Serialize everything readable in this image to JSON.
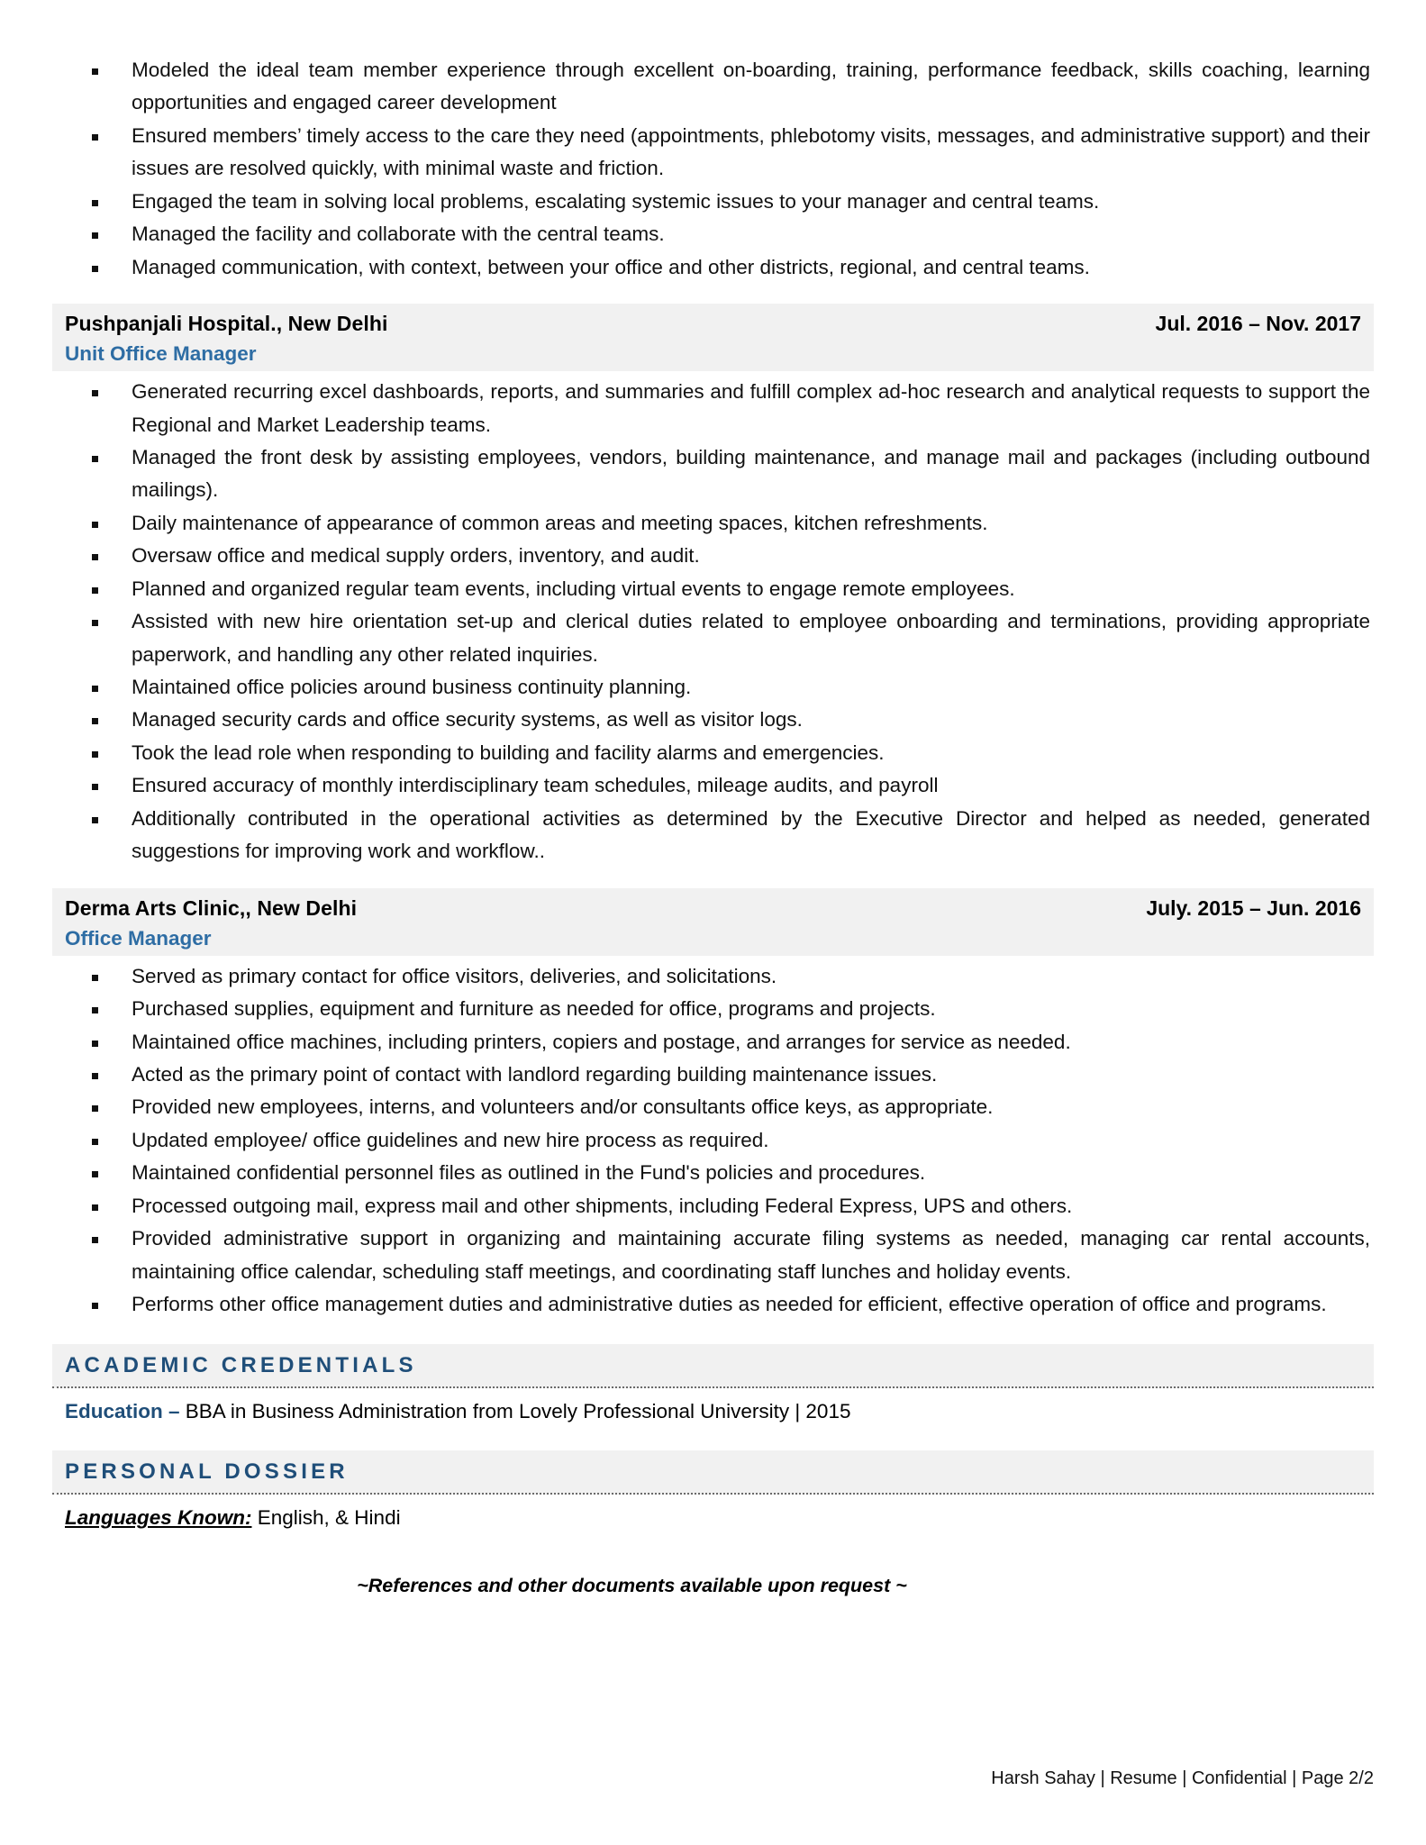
{
  "page": {
    "continued_bullets": [
      "Modeled the ideal team member experience through excellent on-boarding, training, performance feedback, skills coaching, learning opportunities and engaged career development",
      "Ensured members’ timely access to the care they need (appointments, phlebotomy visits, messages, and administrative support) and their issues are resolved quickly, with minimal waste and friction.",
      "Engaged the team in solving local problems, escalating systemic issues to your manager and central teams.",
      "Managed the facility and collaborate with the central teams.",
      "Managed communication, with context, between your office and other districts, regional, and central teams."
    ],
    "jobs": [
      {
        "company": "Pushpanjali Hospital., New Delhi",
        "dates": "Jul. 2016 – Nov. 2017",
        "title": "Unit Office Manager",
        "bullets": [
          "Generated recurring excel dashboards, reports, and summaries and fulfill complex ad-hoc research and analytical requests to support the Regional and Market Leadership teams.",
          "Managed the front desk by assisting employees, vendors, building maintenance, and manage mail and packages (including outbound mailings).",
          "Daily maintenance of appearance of common areas and meeting spaces, kitchen refreshments.",
          "Oversaw office and medical supply orders, inventory, and audit.",
          "Planned and organized regular team events, including virtual events to engage remote employees.",
          "Assisted with new hire orientation set-up and clerical duties related to employee onboarding and terminations, providing appropriate paperwork, and handling any other related inquiries.",
          "Maintained office policies around business continuity planning.",
          "Managed security cards and office security systems, as well as visitor logs.",
          "Took the lead role when responding to building and facility alarms and emergencies.",
          "Ensured accuracy of monthly interdisciplinary team schedules, mileage audits, and payroll",
          "Additionally contributed in the operational activities as determined by the Executive Director and helped as needed, generated suggestions for improving work and workflow.."
        ]
      },
      {
        "company": "Derma Arts Clinic,, New Delhi",
        "dates": "July. 2015 – Jun. 2016",
        "title": "Office Manager",
        "bullets": [
          "Served as primary contact for office visitors, deliveries, and solicitations.",
          "Purchased supplies, equipment and furniture as needed for office, programs and projects.",
          "Maintained office machines, including printers, copiers and postage, and arranges for service as needed.",
          "Acted as the primary point of contact with landlord regarding building maintenance issues.",
          "Provided new employees, interns, and volunteers and/or consultants office keys, as appropriate.",
          "Updated employee/ office guidelines and new hire process as required.",
          "Maintained confidential personnel files as outlined in the Fund's policies and procedures.",
          "Processed outgoing mail, express mail and other shipments, including Federal Express, UPS and others.",
          "Provided administrative support in organizing and maintaining accurate filing systems as needed, managing car rental accounts, maintaining office calendar, scheduling staff meetings, and coordinating staff lunches and holiday events.",
          "Performs other office management duties and administrative duties as needed for efficient, effective operation of office and programs."
        ]
      }
    ],
    "sections": [
      {
        "heading": "ACADEMIC CREDENTIALS",
        "label": "Education –",
        "label_style": "blue",
        "value": " BBA in Business Administration from Lovely Professional University | 2015"
      },
      {
        "heading": "PERSONAL DOSSIER",
        "label": "Languages Known:",
        "label_style": "black-underline",
        "value": " English, & Hindi"
      }
    ],
    "closing_line": "~References and other documents available upon request ~",
    "footer": "Harsh Sahay | Resume | Confidential | Page 2/2"
  },
  "colors": {
    "job_title_blue": "#2e6da4",
    "section_heading_blue": "#1f4e79",
    "band_background": "#f1f1f1",
    "text_black": "#111111"
  }
}
